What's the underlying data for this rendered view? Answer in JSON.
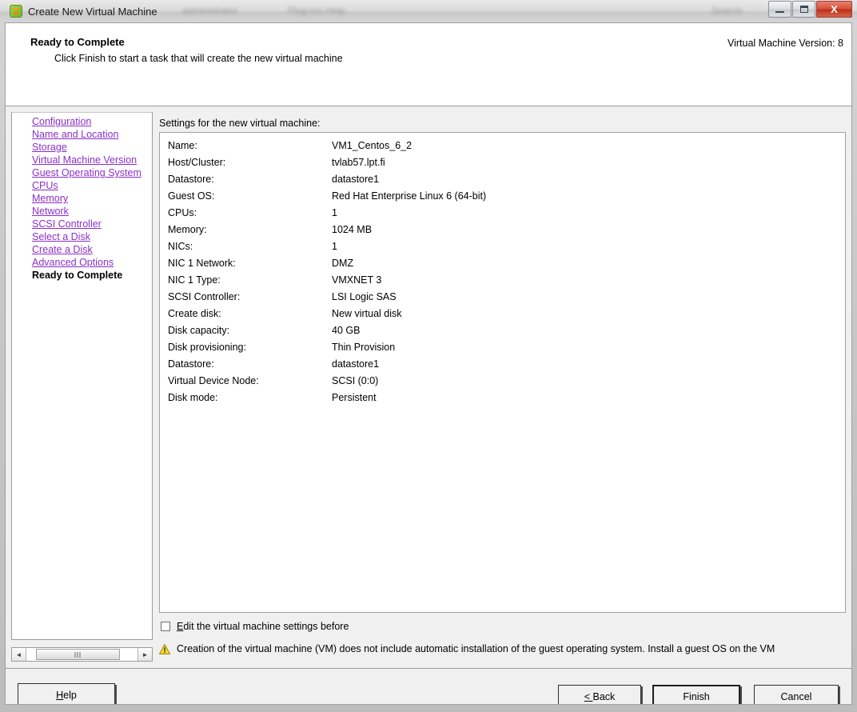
{
  "window": {
    "title": "Create New Virtual Machine",
    "app_icon": "vm-app-icon",
    "ghost_text_1": "administrator",
    "ghost_text_2": "Plug-ins   Help",
    "ghost_text_3": "Search",
    "minimize_label": "Minimize",
    "maximize_label": "Maximize",
    "close_label": "X"
  },
  "header": {
    "title": "Ready to Complete",
    "subtitle": "Click Finish to start a task that will create the new virtual machine",
    "version": "Virtual Machine Version: 8"
  },
  "sidebar": {
    "steps": [
      {
        "label": "Configuration",
        "current": false
      },
      {
        "label": "Name and Location",
        "current": false
      },
      {
        "label": "Storage",
        "current": false
      },
      {
        "label": "Virtual Machine Version",
        "current": false
      },
      {
        "label": "Guest Operating System",
        "current": false
      },
      {
        "label": "CPUs",
        "current": false
      },
      {
        "label": "Memory",
        "current": false
      },
      {
        "label": "Network",
        "current": false
      },
      {
        "label": "SCSI Controller",
        "current": false
      },
      {
        "label": "Select a Disk",
        "current": false
      },
      {
        "label": "Create a Disk",
        "current": false
      },
      {
        "label": "Advanced Options",
        "current": false
      },
      {
        "label": "Ready to Complete",
        "current": true
      }
    ],
    "scrollbar": {
      "left_arrow": "◄",
      "right_arrow": "►"
    }
  },
  "main": {
    "settings_label": "Settings for the new virtual machine:",
    "settings": [
      {
        "label": "Name:",
        "value": "VM1_Centos_6_2"
      },
      {
        "label": "Host/Cluster:",
        "value": "tvlab57.lpt.fi"
      },
      {
        "label": "Datastore:",
        "value": "datastore1"
      },
      {
        "label": "Guest OS:",
        "value": "Red Hat Enterprise Linux 6 (64-bit)"
      },
      {
        "label": "CPUs:",
        "value": "1"
      },
      {
        "label": "Memory:",
        "value": "1024 MB"
      },
      {
        "label": "NICs:",
        "value": "1"
      },
      {
        "label": "NIC 1 Network:",
        "value": "DMZ"
      },
      {
        "label": "NIC 1 Type:",
        "value": "VMXNET 3"
      },
      {
        "label": "SCSI Controller:",
        "value": "LSI Logic SAS"
      },
      {
        "label": "Create disk:",
        "value": "New virtual disk"
      },
      {
        "label": "Disk capacity:",
        "value": "40 GB"
      },
      {
        "label": "Disk provisioning:",
        "value": "Thin Provision"
      },
      {
        "label": "Datastore:",
        "value": "datastore1"
      },
      {
        "label": "Virtual Device Node:",
        "value": "SCSI (0:0)"
      },
      {
        "label": "Disk mode:",
        "value": "Persistent"
      }
    ],
    "edit_checkbox": {
      "accelerator": "E",
      "label_rest": "dit the virtual machine settings before",
      "checked": false
    },
    "warning": {
      "icon": "warning-triangle-icon",
      "text": "Creation of the virtual machine (VM) does not include automatic installation of the guest operating system. Install a guest OS on the VM"
    }
  },
  "buttons": {
    "help_accelerator": "H",
    "help_rest": "elp",
    "back_prefix": "< ",
    "back_accelerator": "",
    "back_label": "Back",
    "finish": "Finish",
    "cancel": "Cancel"
  },
  "colors": {
    "link": "#8b2fc9",
    "warning": "#f0c419",
    "dialog_bg": "#f0f0f0",
    "close_button": "#bb2e17"
  }
}
